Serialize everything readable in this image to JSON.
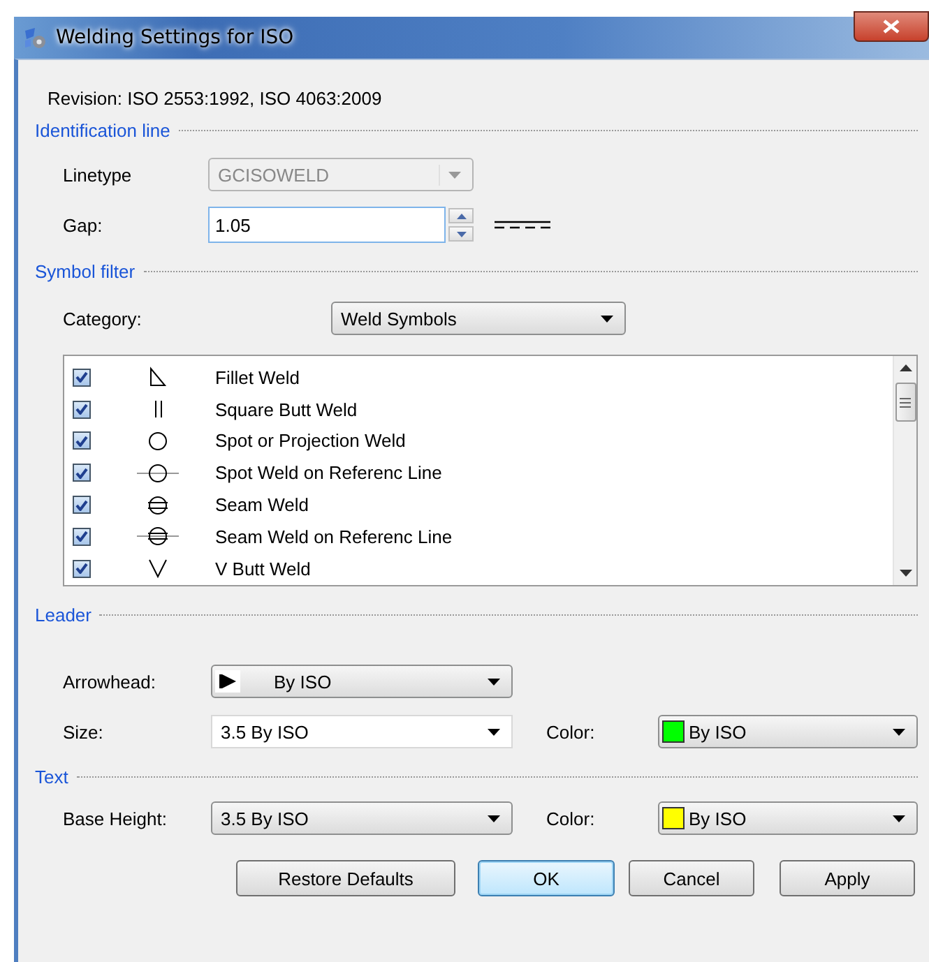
{
  "window": {
    "title": "Welding Settings for ISO"
  },
  "revision": "Revision: ISO 2553:1992, ISO 4063:2009",
  "identification": {
    "heading": "Identification line",
    "linetype_label": "Linetype",
    "linetype": {
      "value": "GCISOWELD",
      "disabled": true
    },
    "gap_label": "Gap:",
    "gap": {
      "value": "1.05"
    }
  },
  "symbol_filter": {
    "heading": "Symbol filter",
    "category_label": "Category:",
    "category": {
      "value": "Weld Symbols"
    },
    "symbols": [
      {
        "kind": "fillet",
        "label": "Fillet Weld",
        "checked": true
      },
      {
        "kind": "square",
        "label": "Square Butt Weld",
        "checked": true
      },
      {
        "kind": "spot",
        "label": "Spot or Projection Weld",
        "checked": true
      },
      {
        "kind": "spot-line",
        "label": "Spot Weld on Referenc Line",
        "checked": true
      },
      {
        "kind": "seam",
        "label": "Seam Weld",
        "checked": true
      },
      {
        "kind": "seam-line",
        "label": "Seam Weld on Referenc Line",
        "checked": true
      },
      {
        "kind": "v-butt",
        "label": "V Butt Weld",
        "checked": true
      }
    ]
  },
  "leader": {
    "heading": "Leader",
    "arrowhead_label": "Arrowhead:",
    "arrowhead": {
      "value": "By ISO"
    },
    "size_label": "Size:",
    "size": {
      "value": "3.5 By ISO"
    },
    "color_label": "Color:",
    "color": {
      "value": "By ISO",
      "color": "#00ff00"
    }
  },
  "text": {
    "heading": "Text",
    "base_height_label": "Base Height:",
    "base_height": {
      "value": "3.5 By ISO"
    },
    "color_label": "Color:",
    "color": {
      "value": "By ISO",
      "color": "#ffff00"
    }
  },
  "buttons": [
    {
      "label": "Restore Defaults",
      "default": false
    },
    {
      "label": "OK",
      "default": true
    },
    {
      "label": "Cancel",
      "default": false
    },
    {
      "label": "Apply",
      "default": false
    }
  ]
}
